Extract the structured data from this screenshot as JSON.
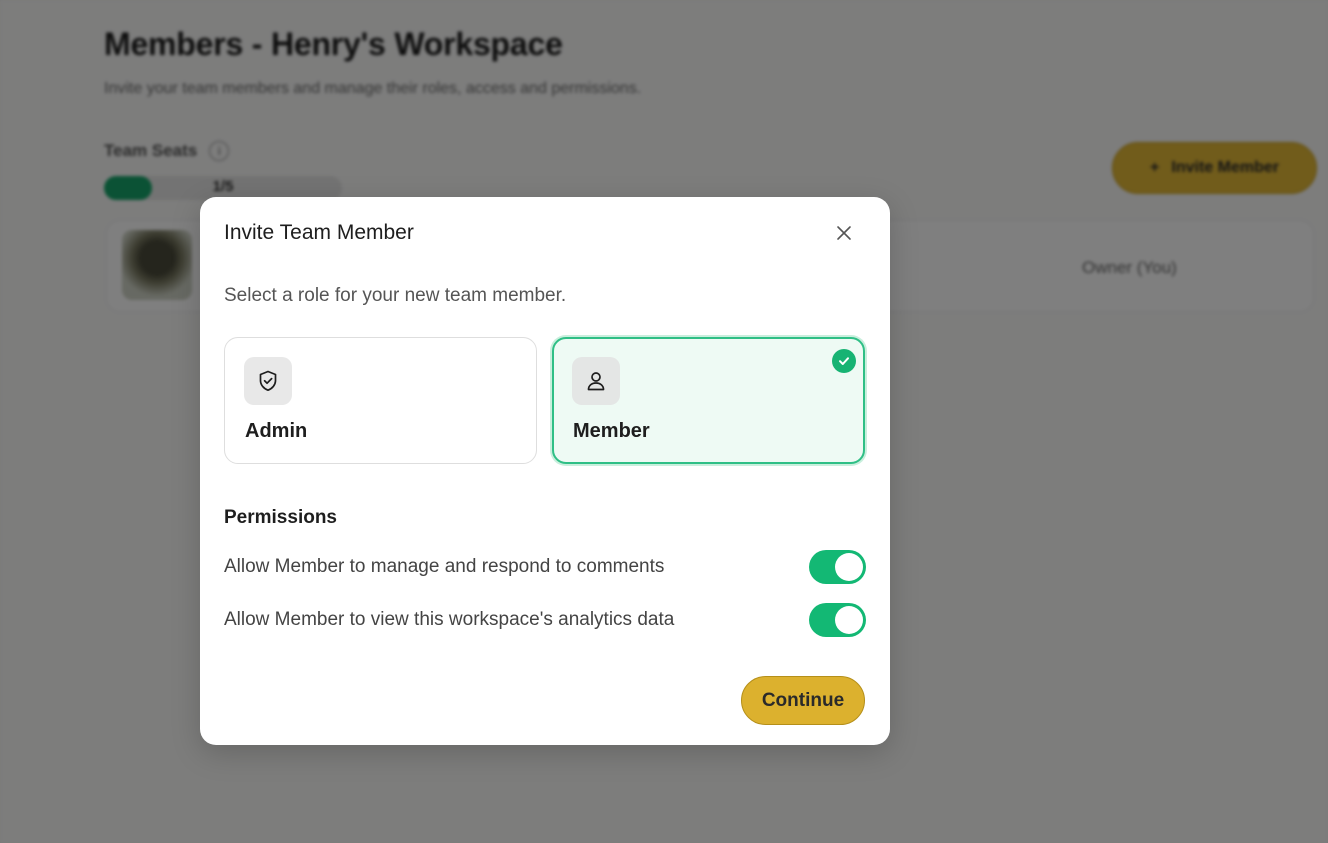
{
  "background": {
    "title": "Members - Henry's Workspace",
    "subtitle": "Invite your team members and manage their roles, access and permissions.",
    "seats_label": "Team Seats",
    "seats_info_icon": "info-icon",
    "seats_count": "1/5",
    "seats_used_fraction": 0.2,
    "invite_button_label": "Invite Member",
    "invite_button_icon": "plus-icon",
    "member_role": "Owner (You)"
  },
  "modal": {
    "title": "Invite Team Member",
    "close_icon": "close-icon",
    "description": "Select a role for your new team member.",
    "roles": [
      {
        "label": "Admin",
        "icon": "shield-check-icon",
        "selected": false
      },
      {
        "label": "Member",
        "icon": "user-icon",
        "selected": true
      }
    ],
    "permissions_heading": "Permissions",
    "permissions": [
      {
        "label": "Allow Member to manage and respond to comments",
        "enabled": true
      },
      {
        "label": "Allow Member to view this workspace's analytics data",
        "enabled": true
      }
    ],
    "continue_label": "Continue"
  },
  "colors": {
    "accent_green": "#13b874",
    "button_yellow": "#dcb12e",
    "selected_card_bg": "#eefaf4"
  }
}
